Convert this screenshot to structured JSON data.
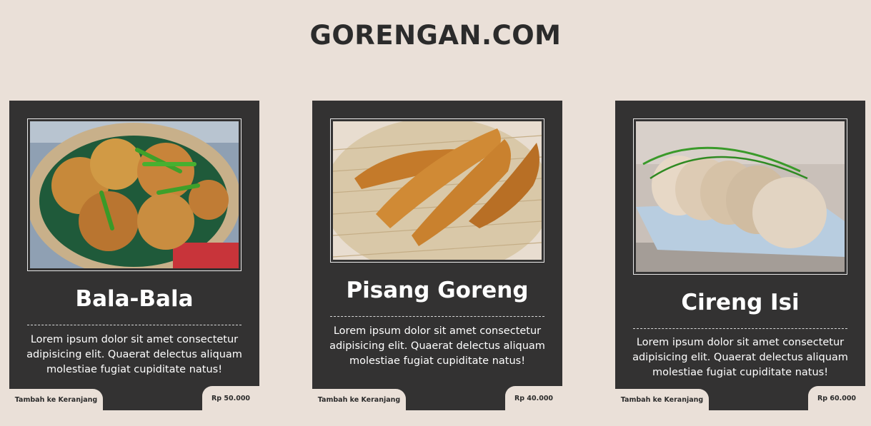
{
  "site": {
    "title": "GORENGAN.COM"
  },
  "products": [
    {
      "name": "Bala-Bala",
      "image": "bala-bala-photo",
      "description": "Lorem ipsum dolor sit amet consectetur adipisicing elit. Quaerat delectus aliquam molestiae fugiat cupiditate natus!",
      "cart_label": "Tambah ke Keranjang",
      "price": "Rp 50.000"
    },
    {
      "name": "Pisang Goreng",
      "image": "pisang-goreng-photo",
      "description": "Lorem ipsum dolor sit amet consectetur adipisicing elit. Quaerat delectus aliquam molestiae fugiat cupiditate natus!",
      "cart_label": "Tambah ke Keranjang",
      "price": "Rp 40.000"
    },
    {
      "name": "Cireng Isi",
      "image": "cireng-isi-photo",
      "description": "Lorem ipsum dolor sit amet consectetur adipisicing elit. Quaerat delectus aliquam molestiae fugiat cupiditate natus!",
      "cart_label": "Tambah ke Keranjang",
      "price": "Rp 60.000"
    }
  ],
  "colors": {
    "background": "#eae0d8",
    "card": "#333232",
    "text_light": "#ffffff",
    "text_dark": "#2b2b2b"
  }
}
